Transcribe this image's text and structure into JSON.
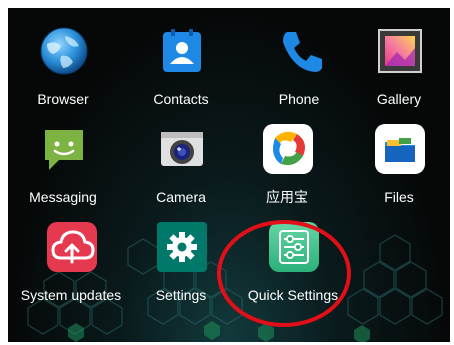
{
  "home_screen": {
    "apps": [
      {
        "name": "browser",
        "label": "Browser",
        "icon": "globe-icon"
      },
      {
        "name": "contacts",
        "label": "Contacts",
        "icon": "contacts-icon"
      },
      {
        "name": "phone",
        "label": "Phone",
        "icon": "phone-icon"
      },
      {
        "name": "gallery",
        "label": "Gallery",
        "icon": "gallery-icon"
      },
      {
        "name": "messaging",
        "label": "Messaging",
        "icon": "message-icon"
      },
      {
        "name": "camera",
        "label": "Camera",
        "icon": "camera-icon"
      },
      {
        "name": "yingyongbao",
        "label": "应用宝",
        "icon": "app-store-icon"
      },
      {
        "name": "files",
        "label": "Files",
        "icon": "files-icon"
      },
      {
        "name": "system-updates",
        "label": "System updates",
        "icon": "cloud-upload-icon"
      },
      {
        "name": "settings",
        "label": "Settings",
        "icon": "gear-icon"
      },
      {
        "name": "quick-settings",
        "label": "Quick Settings",
        "icon": "sliders-icon"
      }
    ],
    "highlight": {
      "target": "Quick Settings",
      "color": "#e10f17"
    }
  }
}
